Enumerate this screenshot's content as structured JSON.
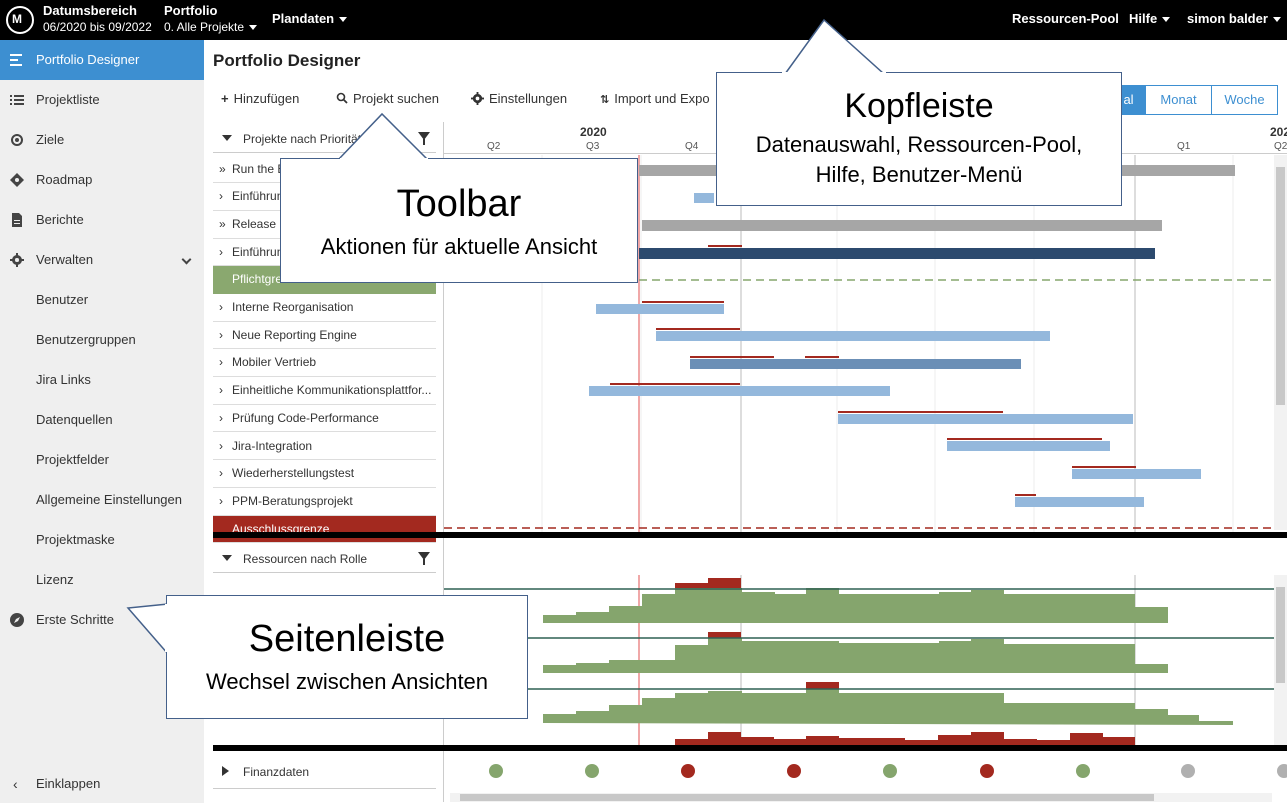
{
  "topbar": {
    "date_range_title": "Datumsbereich",
    "date_range_value": "06/2020 bis 09/2022",
    "portfolio_title": "Portfolio",
    "portfolio_value": "0. Alle Projekte",
    "plandaten": "Plandaten",
    "ressourcen_pool": "Ressourcen-Pool",
    "hilfe": "Hilfe",
    "user": "simon balder"
  },
  "sidebar": {
    "items": [
      {
        "label": "Portfolio Designer",
        "icon": "menu-lines-icon"
      },
      {
        "label": "Projektliste",
        "icon": "list-icon"
      },
      {
        "label": "Ziele",
        "icon": "target-icon"
      },
      {
        "label": "Roadmap",
        "icon": "diamond-icon"
      },
      {
        "label": "Berichte",
        "icon": "document-icon"
      },
      {
        "label": "Verwalten",
        "icon": "gear-icon"
      },
      {
        "label": "Benutzer"
      },
      {
        "label": "Benutzergruppen"
      },
      {
        "label": "Jira Links"
      },
      {
        "label": "Datenquellen"
      },
      {
        "label": "Projektfelder"
      },
      {
        "label": "Allgemeine Einstellungen"
      },
      {
        "label": "Projektmaske"
      },
      {
        "label": "Lizenz"
      },
      {
        "label": "Erste Schritte",
        "icon": "compass-icon"
      }
    ],
    "collapse": "Einklappen"
  },
  "main": {
    "title": "Portfolio Designer",
    "toolbar": {
      "add": "Hinzufügen",
      "search": "Projekt suchen",
      "settings": "Einstellungen",
      "import": "Import und Expo"
    },
    "view_buttons": [
      "al",
      "Monat",
      "Woche"
    ],
    "projects_header": "Projekte nach Prioritäte",
    "projects": [
      {
        "label": "Run the B",
        "chev": "»"
      },
      {
        "label": "Einführun",
        "chev": "›"
      },
      {
        "label": "Release P",
        "chev": "»"
      },
      {
        "label": "Einführun",
        "chev": "›"
      },
      {
        "label": "Pflichtgre",
        "chev": "",
        "style": "green"
      },
      {
        "label": "Interne Reorganisation",
        "chev": "›"
      },
      {
        "label": "Neue Reporting Engine",
        "chev": "›"
      },
      {
        "label": "Mobiler Vertrieb",
        "chev": "›"
      },
      {
        "label": "Einheitliche Kommunikationsplattfor...",
        "chev": "›"
      },
      {
        "label": "Prüfung Code-Performance",
        "chev": "›"
      },
      {
        "label": "Jira-Integration",
        "chev": "›"
      },
      {
        "label": "Wiederherstellungstest",
        "chev": "›"
      },
      {
        "label": "PPM-Beratungsprojekt",
        "chev": "›"
      },
      {
        "label": "Ausschlussgrenze",
        "chev": "",
        "style": "red"
      }
    ],
    "resources_header": "Ressourcen nach Rolle",
    "finance_label": "Finanzdaten",
    "axis": {
      "year_2020": "2020",
      "year_2021": "202",
      "quarters": [
        "Q2",
        "Q3",
        "Q4",
        "Q1",
        "Q2"
      ]
    }
  },
  "callouts": {
    "kopfleiste": {
      "title": "Kopfleiste",
      "line1": "Datenauswahl, Ressourcen-Pool,",
      "line2": "Hilfe, Benutzer-Menü"
    },
    "toolbar": {
      "title": "Toolbar",
      "line1": "Aktionen für aktuelle Ansicht"
    },
    "seitenleiste": {
      "title": "Seitenleiste",
      "line1": "Wechsel zwischen Ansichten"
    }
  },
  "colors": {
    "accent": "#3d8fd1",
    "bar_light": "#94b8dc",
    "bar_dark": "#2c4a6e",
    "bar_grey": "#a6a6a6",
    "overload": "#a3291f",
    "capacity": "#85a56d"
  }
}
